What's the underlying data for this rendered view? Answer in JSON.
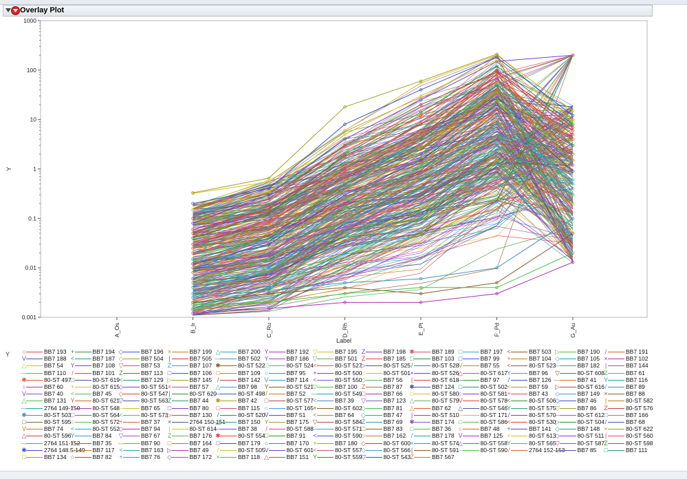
{
  "panel": {
    "title": "Overlay Plot"
  },
  "chart_data": {
    "type": "line",
    "title": "",
    "xlabel": "Label",
    "ylabel": "Y",
    "y_scale": "log",
    "ylim": [
      0.001,
      1000
    ],
    "y_ticks": [
      "0.001",
      "0.01",
      "0.1",
      "1",
      "10",
      "100",
      "1000"
    ],
    "categories": [
      "A_Os",
      "B_Ir",
      "C_Ru",
      "D_Rh",
      "E_Pt",
      "F_Pd",
      "G_Au"
    ],
    "grid": false,
    "legend_position": "bottom",
    "legend_title": "Y",
    "series_count": 400,
    "series": [
      {
        "name": "BB7 193",
        "values": [
          null,
          0.05,
          0.18,
          1.2,
          8,
          60,
          5
        ]
      },
      {
        "name": "BB7 194",
        "values": [
          null,
          0.01,
          0.05,
          0.5,
          3,
          40,
          2
        ]
      },
      {
        "name": "BB7 196",
        "values": [
          null,
          0.32,
          0.55,
          6,
          55,
          200,
          15
        ]
      },
      {
        "name": "BB7 199",
        "values": [
          null,
          0.003,
          0.01,
          0.08,
          0.6,
          12,
          0.5
        ]
      },
      {
        "name": "BB7 200",
        "values": [
          null,
          0.02,
          0.08,
          0.9,
          6,
          80,
          3
        ]
      },
      {
        "name": "BB7 192",
        "values": [
          null,
          0.33,
          0.65,
          18,
          60,
          210,
          10
        ]
      },
      {
        "name": "BB7 195",
        "values": [
          null,
          0.006,
          0.02,
          0.2,
          2,
          30,
          1.2
        ]
      },
      {
        "name": "BB7 198",
        "values": [
          null,
          0.04,
          0.12,
          2,
          14,
          120,
          8
        ]
      },
      {
        "name": "BB7 189",
        "values": [
          null,
          0.0015,
          0.004,
          0.02,
          0.1,
          3,
          0.3
        ]
      },
      {
        "name": "BB7 197",
        "values": [
          null,
          0.08,
          0.3,
          4,
          25,
          150,
          200
        ]
      },
      {
        "name": "BB7 503",
        "values": [
          null,
          0.002,
          0.003,
          0.004,
          0.003,
          0.005,
          0.05
        ]
      },
      {
        "name": "BB7 190",
        "values": [
          null,
          0.012,
          0.03,
          0.3,
          1.5,
          20,
          0.9
        ]
      },
      {
        "name": "BB7 191",
        "values": [
          null,
          0.1,
          0.25,
          3,
          20,
          90,
          6
        ]
      },
      {
        "name": "BB7 188",
        "values": [
          null,
          0.005,
          0.015,
          0.15,
          1.2,
          25,
          0.4
        ]
      },
      {
        "name": "BB7 187",
        "values": [
          null,
          0.2,
          0.4,
          8,
          40,
          180,
          12
        ]
      },
      {
        "name": "BB7 504",
        "values": [
          null,
          0.0012,
          0.0015,
          0.002,
          0.002,
          0.003,
          0.013
        ]
      },
      {
        "name": "BB7 505",
        "values": [
          null,
          0.03,
          0.09,
          1,
          9,
          70,
          200
        ]
      },
      {
        "name": "BB7 502",
        "values": [
          null,
          0.0018,
          0.002,
          0.003,
          0.004,
          0.004,
          0.02
        ]
      },
      {
        "name": "BB7 186",
        "values": [
          null,
          0.015,
          0.04,
          0.5,
          4,
          50,
          3
        ]
      },
      {
        "name": "BB7 501",
        "values": [
          null,
          0.0025,
          0.0035,
          0.005,
          0.006,
          0.01,
          0.1
        ]
      },
      {
        "name": "BB7 185",
        "values": [
          null,
          0.06,
          0.15,
          1.8,
          12,
          100,
          7
        ]
      },
      {
        "name": "BB7 103",
        "values": [
          null,
          0.008,
          0.025,
          0.25,
          2.5,
          35,
          1.5
        ]
      },
      {
        "name": "BB7 99",
        "values": [
          null,
          0.15,
          0.35,
          5,
          30,
          160,
          9
        ]
      },
      {
        "name": "BB7 104",
        "values": [
          null,
          0.004,
          0.008,
          0.06,
          0.4,
          8,
          0.6
        ]
      },
      {
        "name": "BB7 105",
        "values": [
          null,
          0.025,
          0.06,
          0.7,
          5,
          60,
          4
        ]
      },
      {
        "name": "BB7 102",
        "values": [
          null,
          0.0014,
          0.002,
          0.01,
          0.05,
          1.5,
          0.2
        ]
      }
    ],
    "legend_entries": [
      [
        "○",
        "BB7 193"
      ],
      [
        "+",
        "BB7 194"
      ],
      [
        "◇",
        "BB7 196"
      ],
      [
        "×",
        "BB7 199"
      ],
      [
        "△",
        "BB7 200"
      ],
      [
        "Y",
        "BB7 192"
      ],
      [
        "▽",
        "BB7 195"
      ],
      [
        "Z",
        "BB7 198"
      ],
      [
        "✱",
        "BB7 189"
      ],
      [
        "□",
        "BB7 197"
      ],
      [
        "<",
        "BB7 503"
      ],
      [
        "▷",
        "BB7 190"
      ],
      [
        "/",
        "BB7 191"
      ],
      [
        "V",
        "BB7 188"
      ],
      [
        "<",
        "BB7 187"
      ],
      [
        "◇",
        "BB7 504"
      ],
      [
        "|",
        "BB7 505"
      ],
      [
        "—",
        "BB7 502"
      ],
      [
        "Y",
        "BB7 186"
      ],
      [
        "▽",
        "BB7 501"
      ],
      [
        "Z",
        "BB7 185"
      ],
      [
        "□",
        "BB7 103"
      ],
      [
        "□",
        "BB7 99"
      ],
      [
        "+",
        "BB7 104"
      ],
      [
        "◇",
        "BB7 105"
      ],
      [
        "×",
        "BB7 102"
      ],
      [
        "△",
        "BB7 54"
      ],
      [
        "Y",
        "BB7 108"
      ],
      [
        "▽",
        "BB7 53"
      ],
      [
        "Z",
        "BB7 107"
      ],
      [
        "✱",
        "80-ST 522"
      ],
      [
        "□",
        "80-ST 524"
      ],
      [
        "<",
        "80-ST 527"
      ],
      [
        "▷",
        "80-ST 525"
      ],
      [
        "/",
        "80-ST 528"
      ],
      [
        "V",
        "BB7 55"
      ],
      [
        "<",
        "80-ST 523"
      ],
      [
        "—",
        "BB7 182"
      ],
      [
        "|",
        "BB7 144"
      ],
      [
        "—",
        "BB7 110"
      ],
      [
        "/",
        "BB7 101"
      ],
      [
        "Z",
        "BB7 113"
      ],
      [
        "□",
        "BB7 106"
      ],
      [
        "□",
        "BB7 109"
      ],
      [
        "○",
        "BB7 95"
      ],
      [
        "+",
        "80-ST 500"
      ],
      [
        "○",
        "80-ST 501"
      ],
      [
        "×",
        "80-ST 526"
      ],
      [
        "△",
        "80-ST 617"
      ],
      [
        "Y",
        "BB7 96"
      ],
      [
        "▽",
        "80-ST 608"
      ],
      [
        "Z",
        "BB7 61"
      ],
      [
        "✱",
        "80-ST 497"
      ],
      [
        "□",
        "80-ST 619"
      ],
      [
        "<",
        "BB7 129"
      ],
      [
        "▷",
        "BB7 145"
      ],
      [
        "/",
        "BB7 142"
      ],
      [
        "V",
        "BB7 114"
      ],
      [
        "<",
        "80-ST 550"
      ],
      [
        "◇",
        "BB7 56"
      ],
      [
        "|",
        "80-ST 618"
      ],
      [
        "—",
        "BB7 97"
      ],
      [
        "/",
        "BB7 126"
      ],
      [
        "—",
        "BB7 41"
      ],
      [
        "Y",
        "BB7 116"
      ],
      [
        "○",
        "BB7 60"
      ],
      [
        "+",
        "80-ST 615"
      ],
      [
        "◇",
        "80-ST 551"
      ],
      [
        "×",
        "BB7 57"
      ],
      [
        "△",
        "BB7 98"
      ],
      [
        "Y",
        "80-ST 521"
      ],
      [
        "▽",
        "BB7 100"
      ],
      [
        "Z",
        "BB7 87"
      ],
      [
        "✱",
        "BB7 124"
      ],
      [
        "□",
        "80-ST 502"
      ],
      [
        "<",
        "BB7 59"
      ],
      [
        "▷",
        "80-ST 616"
      ],
      [
        "/",
        "BB7 89"
      ],
      [
        "V",
        "BB7 40"
      ],
      [
        "<",
        "BB7 45"
      ],
      [
        "◇",
        "80-ST 547"
      ],
      [
        "|",
        "80-ST 620"
      ],
      [
        "—",
        "80-ST 498"
      ],
      [
        "/",
        "BB7 52"
      ],
      [
        "—",
        "80-ST 549"
      ],
      [
        "□",
        "BB7 66"
      ],
      [
        "□",
        "80-ST 580"
      ],
      [
        "○",
        "80-ST 581"
      ],
      [
        "+",
        "BB7 43"
      ],
      [
        "◇",
        "BB7 149"
      ],
      [
        "×",
        "BB7 88"
      ],
      [
        "△",
        "BB7 131"
      ],
      [
        "Y",
        "80-ST 621"
      ],
      [
        "▽",
        "80-ST 563"
      ],
      [
        "Z",
        "BB7 44"
      ],
      [
        "✱",
        "BB7 42"
      ],
      [
        "□",
        "80-ST 577"
      ],
      [
        "<",
        "BB7 39"
      ],
      [
        "▽",
        "BB7 123"
      ],
      [
        "△",
        "80-ST 579"
      ],
      [
        "V",
        "80-ST 578"
      ],
      [
        "<",
        "80-ST 506"
      ],
      [
        "◇",
        "BB7 46"
      ],
      [
        "|",
        "80-ST 582"
      ],
      [
        "—",
        "2764 149-150"
      ],
      [
        "/",
        "80-ST 548"
      ],
      [
        "—",
        "BB7 65"
      ],
      [
        "□",
        "BB7 80"
      ],
      [
        "□",
        "BB7 115"
      ],
      [
        "○",
        "80-ST 165"
      ],
      [
        "+",
        "80-ST 602"
      ],
      [
        "◇",
        "BB7 81"
      ],
      [
        "△",
        "BB7 62"
      ],
      [
        "△",
        "80-ST 546"
      ],
      [
        "Y",
        "80-ST 575"
      ],
      [
        "▽",
        "BB7 86"
      ],
      [
        "Z",
        "80-ST 576"
      ],
      [
        "✱",
        "80-ST 503"
      ],
      [
        "□",
        "80-ST 564"
      ],
      [
        "<",
        "80-ST 573"
      ],
      [
        "▷",
        "BB7 130"
      ],
      [
        "/",
        "80-ST 520"
      ],
      [
        "V",
        "BB7 51"
      ],
      [
        "<",
        "BB7 64"
      ],
      [
        "◇",
        "BB7 47"
      ],
      [
        "|",
        "80-ST 510"
      ],
      [
        "—",
        "80-ST 171"
      ],
      [
        "/",
        "80-ST 570"
      ],
      [
        "—",
        "80-ST 612"
      ],
      [
        "□",
        "BB7 166"
      ],
      [
        "□",
        "80-ST 595"
      ],
      [
        "○",
        "80-ST 572"
      ],
      [
        "+",
        "BB7 37"
      ],
      [
        "×",
        "2764 150-151"
      ],
      [
        "△",
        "BB7 150"
      ],
      [
        "Y",
        "BB7 175"
      ],
      [
        "▽",
        "80-ST 584"
      ],
      [
        "Z",
        "BB7 69"
      ],
      [
        "✱",
        "BB7 174"
      ],
      [
        "□",
        "80-ST 586"
      ],
      [
        "<",
        "80-ST 530"
      ],
      [
        "▷",
        "80-ST 504"
      ],
      [
        "/",
        "BB7 68"
      ],
      [
        "V",
        "BB7 74"
      ],
      [
        "<",
        "80-ST 552"
      ],
      [
        "◇",
        "BB7 94"
      ],
      [
        "|",
        "80-ST 614"
      ],
      [
        "—",
        "BB7 38"
      ],
      [
        "/",
        "80-ST 588"
      ],
      [
        "—",
        "80-ST 571"
      ],
      [
        "□",
        "BB7 83"
      ],
      [
        "□",
        "BB7 36"
      ],
      [
        "○",
        "BB7 48"
      ],
      [
        "+",
        "BB7 141"
      ],
      [
        "◇",
        "BB7 148"
      ],
      [
        "×",
        "80-ST 622"
      ],
      [
        "△",
        "80-ST 596"
      ],
      [
        "Y",
        "BB7 84"
      ],
      [
        "▽",
        "BB7 67"
      ],
      [
        "Z",
        "BB7 176"
      ],
      [
        "✱",
        "80-ST 554"
      ],
      [
        "□",
        "BB7 91"
      ],
      [
        "<",
        "80-ST 590"
      ],
      [
        "▷",
        "BB7 162"
      ],
      [
        "/",
        "BB7 178"
      ],
      [
        "V",
        "BB7 125"
      ],
      [
        "<",
        "80-ST 613"
      ],
      [
        "◇",
        "80-ST 511"
      ],
      [
        "|",
        "80-ST 560"
      ],
      [
        "—",
        "2764 151-152"
      ],
      [
        "/",
        "BB7 35"
      ],
      [
        "—",
        "BB7 90"
      ],
      [
        "□",
        "BB7 164"
      ],
      [
        "□",
        "BB7 179"
      ],
      [
        "○",
        "BB7 170"
      ],
      [
        "+",
        "BB7 180"
      ],
      [
        "◇",
        "80-ST 600"
      ],
      [
        "×",
        "80-ST 574"
      ],
      [
        "△",
        "80-ST 558"
      ],
      [
        "Y",
        "80-ST 565"
      ],
      [
        "▽",
        "80-ST 587"
      ],
      [
        "Z",
        "80-ST 598"
      ],
      [
        "✱",
        "2764 148.5-149"
      ],
      [
        "□",
        "BB7 117"
      ],
      [
        "<",
        "BB7 163"
      ],
      [
        "▷",
        "BB7 49"
      ],
      [
        "/",
        "80-ST 505"
      ],
      [
        "V",
        "80-ST 601"
      ],
      [
        "<",
        "80-ST 557"
      ],
      [
        "◇",
        "80-ST 566"
      ],
      [
        "|",
        "80-ST 591"
      ],
      [
        "—",
        "80-ST 590"
      ],
      [
        "/",
        "2764 152-153"
      ],
      [
        "—",
        "BB7 85"
      ],
      [
        "□",
        "BB7 111"
      ],
      [
        "□",
        "BB7 134"
      ],
      [
        "○",
        "BB7 82"
      ],
      [
        "+",
        "BB7 76"
      ],
      [
        "◇",
        "BB7 172"
      ],
      [
        "×",
        "BB7 118"
      ],
      [
        "△",
        "BB7 151"
      ],
      [
        "Y",
        "80-ST 559"
      ],
      [
        "▽",
        "80-ST 543"
      ],
      [
        "Z",
        "BB7 567"
      ]
    ]
  }
}
